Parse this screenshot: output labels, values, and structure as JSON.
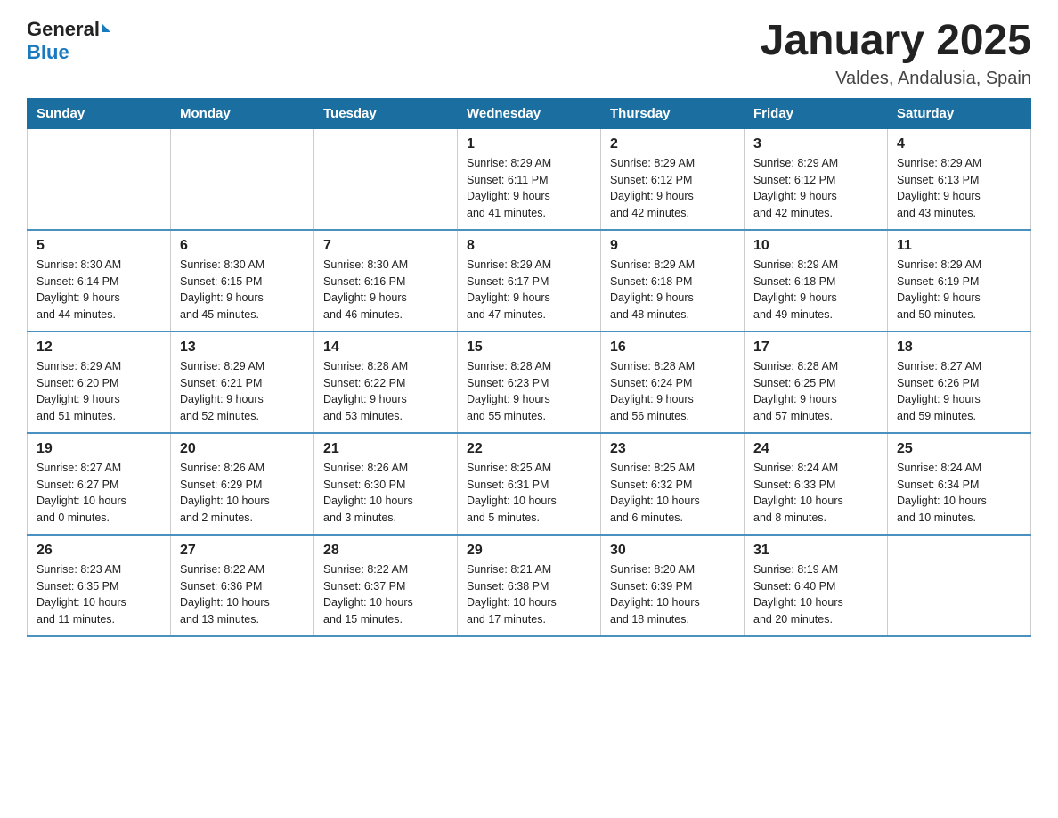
{
  "logo": {
    "text_general": "General",
    "text_blue": "Blue",
    "arrow": "▶"
  },
  "header": {
    "title": "January 2025",
    "subtitle": "Valdes, Andalusia, Spain"
  },
  "weekdays": [
    "Sunday",
    "Monday",
    "Tuesday",
    "Wednesday",
    "Thursday",
    "Friday",
    "Saturday"
  ],
  "weeks": [
    [
      {
        "day": "",
        "info": ""
      },
      {
        "day": "",
        "info": ""
      },
      {
        "day": "",
        "info": ""
      },
      {
        "day": "1",
        "info": "Sunrise: 8:29 AM\nSunset: 6:11 PM\nDaylight: 9 hours\nand 41 minutes."
      },
      {
        "day": "2",
        "info": "Sunrise: 8:29 AM\nSunset: 6:12 PM\nDaylight: 9 hours\nand 42 minutes."
      },
      {
        "day": "3",
        "info": "Sunrise: 8:29 AM\nSunset: 6:12 PM\nDaylight: 9 hours\nand 42 minutes."
      },
      {
        "day": "4",
        "info": "Sunrise: 8:29 AM\nSunset: 6:13 PM\nDaylight: 9 hours\nand 43 minutes."
      }
    ],
    [
      {
        "day": "5",
        "info": "Sunrise: 8:30 AM\nSunset: 6:14 PM\nDaylight: 9 hours\nand 44 minutes."
      },
      {
        "day": "6",
        "info": "Sunrise: 8:30 AM\nSunset: 6:15 PM\nDaylight: 9 hours\nand 45 minutes."
      },
      {
        "day": "7",
        "info": "Sunrise: 8:30 AM\nSunset: 6:16 PM\nDaylight: 9 hours\nand 46 minutes."
      },
      {
        "day": "8",
        "info": "Sunrise: 8:29 AM\nSunset: 6:17 PM\nDaylight: 9 hours\nand 47 minutes."
      },
      {
        "day": "9",
        "info": "Sunrise: 8:29 AM\nSunset: 6:18 PM\nDaylight: 9 hours\nand 48 minutes."
      },
      {
        "day": "10",
        "info": "Sunrise: 8:29 AM\nSunset: 6:18 PM\nDaylight: 9 hours\nand 49 minutes."
      },
      {
        "day": "11",
        "info": "Sunrise: 8:29 AM\nSunset: 6:19 PM\nDaylight: 9 hours\nand 50 minutes."
      }
    ],
    [
      {
        "day": "12",
        "info": "Sunrise: 8:29 AM\nSunset: 6:20 PM\nDaylight: 9 hours\nand 51 minutes."
      },
      {
        "day": "13",
        "info": "Sunrise: 8:29 AM\nSunset: 6:21 PM\nDaylight: 9 hours\nand 52 minutes."
      },
      {
        "day": "14",
        "info": "Sunrise: 8:28 AM\nSunset: 6:22 PM\nDaylight: 9 hours\nand 53 minutes."
      },
      {
        "day": "15",
        "info": "Sunrise: 8:28 AM\nSunset: 6:23 PM\nDaylight: 9 hours\nand 55 minutes."
      },
      {
        "day": "16",
        "info": "Sunrise: 8:28 AM\nSunset: 6:24 PM\nDaylight: 9 hours\nand 56 minutes."
      },
      {
        "day": "17",
        "info": "Sunrise: 8:28 AM\nSunset: 6:25 PM\nDaylight: 9 hours\nand 57 minutes."
      },
      {
        "day": "18",
        "info": "Sunrise: 8:27 AM\nSunset: 6:26 PM\nDaylight: 9 hours\nand 59 minutes."
      }
    ],
    [
      {
        "day": "19",
        "info": "Sunrise: 8:27 AM\nSunset: 6:27 PM\nDaylight: 10 hours\nand 0 minutes."
      },
      {
        "day": "20",
        "info": "Sunrise: 8:26 AM\nSunset: 6:29 PM\nDaylight: 10 hours\nand 2 minutes."
      },
      {
        "day": "21",
        "info": "Sunrise: 8:26 AM\nSunset: 6:30 PM\nDaylight: 10 hours\nand 3 minutes."
      },
      {
        "day": "22",
        "info": "Sunrise: 8:25 AM\nSunset: 6:31 PM\nDaylight: 10 hours\nand 5 minutes."
      },
      {
        "day": "23",
        "info": "Sunrise: 8:25 AM\nSunset: 6:32 PM\nDaylight: 10 hours\nand 6 minutes."
      },
      {
        "day": "24",
        "info": "Sunrise: 8:24 AM\nSunset: 6:33 PM\nDaylight: 10 hours\nand 8 minutes."
      },
      {
        "day": "25",
        "info": "Sunrise: 8:24 AM\nSunset: 6:34 PM\nDaylight: 10 hours\nand 10 minutes."
      }
    ],
    [
      {
        "day": "26",
        "info": "Sunrise: 8:23 AM\nSunset: 6:35 PM\nDaylight: 10 hours\nand 11 minutes."
      },
      {
        "day": "27",
        "info": "Sunrise: 8:22 AM\nSunset: 6:36 PM\nDaylight: 10 hours\nand 13 minutes."
      },
      {
        "day": "28",
        "info": "Sunrise: 8:22 AM\nSunset: 6:37 PM\nDaylight: 10 hours\nand 15 minutes."
      },
      {
        "day": "29",
        "info": "Sunrise: 8:21 AM\nSunset: 6:38 PM\nDaylight: 10 hours\nand 17 minutes."
      },
      {
        "day": "30",
        "info": "Sunrise: 8:20 AM\nSunset: 6:39 PM\nDaylight: 10 hours\nand 18 minutes."
      },
      {
        "day": "31",
        "info": "Sunrise: 8:19 AM\nSunset: 6:40 PM\nDaylight: 10 hours\nand 20 minutes."
      },
      {
        "day": "",
        "info": ""
      }
    ]
  ]
}
